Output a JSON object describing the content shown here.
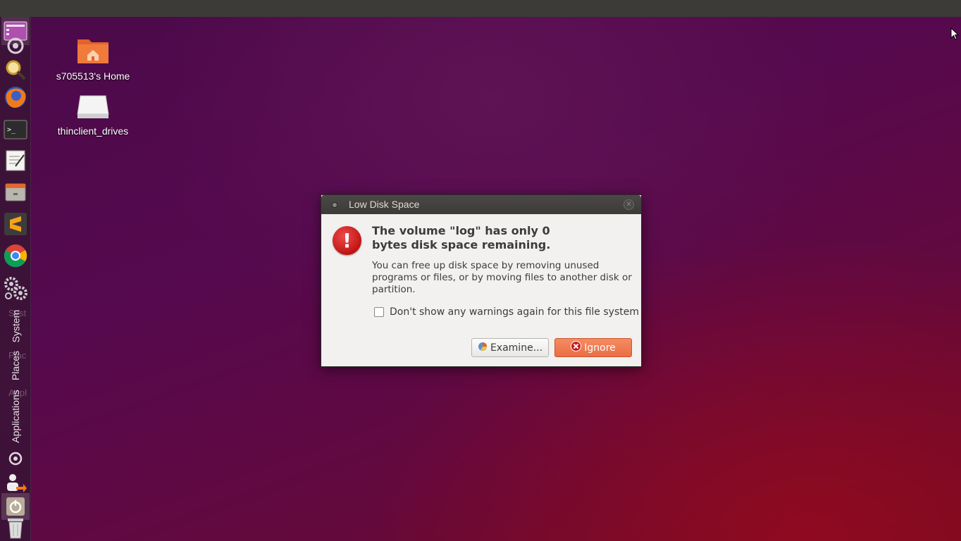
{
  "desktop": {
    "icons": [
      {
        "label": "s705513's Home",
        "icon": "home-folder-icon"
      },
      {
        "label": "thinclient_drives",
        "icon": "drive-icon"
      }
    ]
  },
  "launcher": {
    "items": [
      {
        "icon": "workspace-switcher-icon"
      },
      {
        "icon": "ubuntu-settings-icon"
      },
      {
        "icon": "search-icon"
      },
      {
        "icon": "firefox-icon"
      },
      {
        "icon": "terminal-icon"
      },
      {
        "icon": "text-editor-icon"
      },
      {
        "icon": "file-manager-icon"
      },
      {
        "icon": "sublime-text-icon"
      },
      {
        "icon": "chrome-icon"
      },
      {
        "icon": "system-settings-icon"
      }
    ],
    "menus": [
      "System",
      "Places",
      "Applications"
    ],
    "ghost_menus": [
      "Syst",
      "Plac",
      "Appl"
    ],
    "bottom_items": [
      {
        "icon": "ubuntu-logo-icon"
      },
      {
        "icon": "logout-icon"
      },
      {
        "icon": "power-icon"
      },
      {
        "icon": "trash-icon"
      }
    ]
  },
  "dialog": {
    "title": "Low Disk Space",
    "headline": "The volume \"log\" has only 0 bytes disk space remaining.",
    "headline_line1": "The volume \"log\" has only 0",
    "headline_line2": "bytes disk space remaining.",
    "body": "You can free up disk space by removing unused programs or files, or by moving files to another disk or partition.",
    "checkbox_label": "Don't show any warnings again for this file system",
    "checkbox_checked": false,
    "examine_label": "Examine...",
    "ignore_label": "Ignore",
    "accent_color": "#ea6e43",
    "error_color": "#c01414"
  }
}
